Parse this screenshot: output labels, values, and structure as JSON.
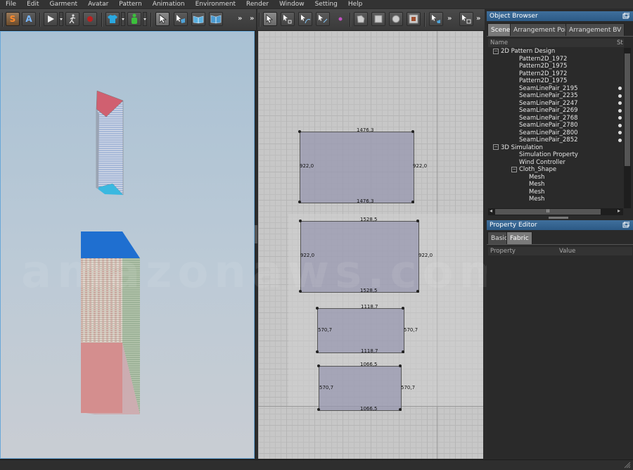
{
  "menubar": [
    "File",
    "Edit",
    "Garment",
    "Avatar",
    "Pattern",
    "Animation",
    "Environment",
    "Render",
    "Window",
    "Setting",
    "Help"
  ],
  "toolbar_left": {
    "s_label": "S",
    "a_label": "A",
    "more": "»"
  },
  "toolbar_right": {
    "more1": "»",
    "more2": "»"
  },
  "watermark": "amazonaws.com",
  "patterns": [
    {
      "top": "1476,3",
      "bottom": "1476,3",
      "left": "922,0",
      "right": "922,0"
    },
    {
      "top": "1528,5",
      "bottom": "1528,5",
      "left": "922,0",
      "right": "922,0"
    },
    {
      "top": "1118,7",
      "bottom": "1118,7",
      "left": "570,7",
      "right": "570,7"
    },
    {
      "top": "1066,5",
      "bottom": "1066,5",
      "left": "570,7",
      "right": "570,7"
    }
  ],
  "object_browser": {
    "title": "Object Browser",
    "tabs": [
      "Scene",
      "Arrangement Point",
      "Arrangement BV"
    ],
    "col_name": "Name",
    "col_s": "St",
    "tree": [
      {
        "label": "2D Pattern Design",
        "level": 0,
        "expander": "−"
      },
      {
        "label": "Pattern2D_1972",
        "level": 1
      },
      {
        "label": "Pattern2D_1975",
        "level": 1
      },
      {
        "label": "Pattern2D_1972",
        "level": 1
      },
      {
        "label": "Pattern2D_1975",
        "level": 1
      },
      {
        "label": "SeamLinePair_2195",
        "level": 1,
        "dot": true
      },
      {
        "label": "SeamLinePair_2235",
        "level": 1,
        "dot": true
      },
      {
        "label": "SeamLinePair_2247",
        "level": 1,
        "dot": true
      },
      {
        "label": "SeamLinePair_2269",
        "level": 1,
        "dot": true
      },
      {
        "label": "SeamLinePair_2768",
        "level": 1,
        "dot": true
      },
      {
        "label": "SeamLinePair_2780",
        "level": 1,
        "dot": true
      },
      {
        "label": "SeamLinePair_2800",
        "level": 1,
        "dot": true
      },
      {
        "label": "SeamLinePair_2852",
        "level": 1,
        "dot": true
      },
      {
        "label": "3D Simulation",
        "level": 0,
        "expander": "−"
      },
      {
        "label": "Simulation Property",
        "level": 1
      },
      {
        "label": "Wind Controller",
        "level": 1
      },
      {
        "label": "Cloth_Shape",
        "level": 1,
        "expander": "−"
      },
      {
        "label": "Mesh",
        "level": 2
      },
      {
        "label": "Mesh",
        "level": 2
      },
      {
        "label": "Mesh",
        "level": 2
      },
      {
        "label": "Mesh",
        "level": 2
      }
    ],
    "scroll_center": "III"
  },
  "property_editor": {
    "title": "Property Editor",
    "tabs": [
      "Basic",
      "Fabric"
    ],
    "col_property": "Property",
    "col_value": "Value"
  },
  "colors": {
    "accent": "#3a6a96",
    "viewport_border": "#6aa8d8",
    "pattern_fill": "#9696af"
  }
}
